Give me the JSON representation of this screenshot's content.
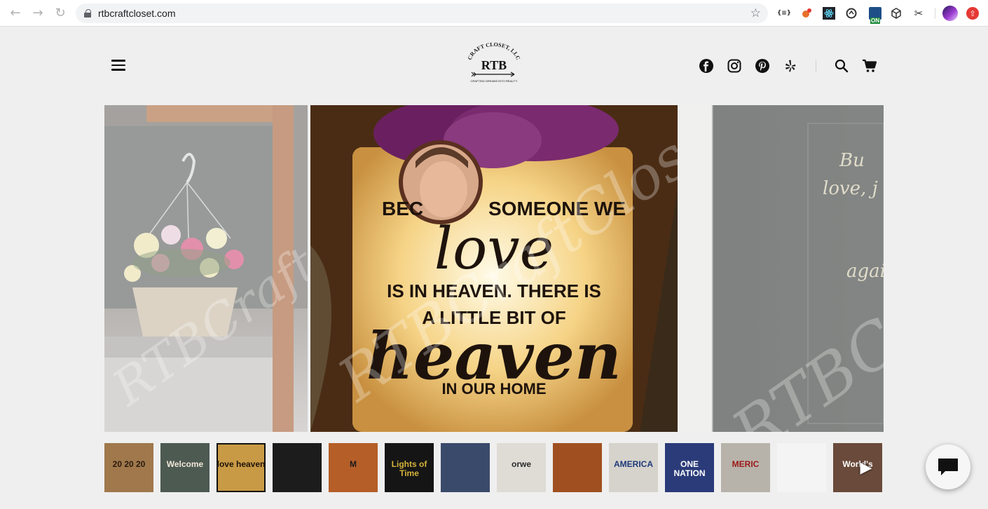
{
  "browser": {
    "url": "rtbcraftcloset.com",
    "back_icon": "arrow-left-icon",
    "forward_icon": "arrow-right-icon",
    "reload_icon": "reload-icon",
    "extensions": [
      "json-viewer-icon",
      "extension-badge-icon",
      "react-devtools-icon",
      "extension-ring-icon",
      "extension-on-icon",
      "cube-icon",
      "scissors-icon",
      "profile-avatar-icon",
      "update-icon"
    ],
    "extension_badge": "ON"
  },
  "site": {
    "logo": {
      "arc_text": "CRAFT CLOSET, LLC",
      "initials": "RTB",
      "tagline": "CRAFTING DREAMS INTO REALITY"
    },
    "social": [
      "facebook-icon",
      "instagram-icon",
      "pinterest-icon",
      "yelp-icon"
    ],
    "actions": [
      "search-icon",
      "cart-icon"
    ],
    "accent": "#111111"
  },
  "slides": {
    "watermark": "RTBCraftCloset",
    "main_text": {
      "line1": "BEC",
      "line1b": "SOMEONE WE",
      "line2": "love",
      "line3": "IS IN HEAVEN. THERE IS",
      "line4": "A LITTLE BIT OF",
      "line5": "heaven",
      "line6": "IN OUR HOME"
    },
    "right_text": {
      "line1": "Bu",
      "line2": "love, j",
      "line3": "agains"
    }
  },
  "thumbnails": [
    {
      "label": "20 20 20",
      "bg": "#a0784c",
      "color": "#2b1a0d"
    },
    {
      "label": "Welcome",
      "bg": "#4c5a52",
      "color": "#f1e7d8"
    },
    {
      "label": "love heaven",
      "bg": "#c99a45",
      "color": "#1e130c"
    },
    {
      "label": "",
      "bg": "#1c1c1c",
      "color": "#d8d0a0"
    },
    {
      "label": "M",
      "bg": "#b55e28",
      "color": "#1a1a1a"
    },
    {
      "label": "Lights of Time",
      "bg": "#151515",
      "color": "#d4b23a"
    },
    {
      "label": "",
      "bg": "#3a4a6a",
      "color": "#ffffff"
    },
    {
      "label": "orwe",
      "bg": "#dfdcd5",
      "color": "#2a2a2a"
    },
    {
      "label": "",
      "bg": "#a05020",
      "color": "#111111"
    },
    {
      "label": "AMERICA",
      "bg": "#d6d3cc",
      "color": "#1f3a7a"
    },
    {
      "label": "ONE NATION",
      "bg": "#2b3b7a",
      "color": "#ffffff"
    },
    {
      "label": "MERIC",
      "bg": "#b8b3aa",
      "color": "#9a1a1a"
    },
    {
      "label": "",
      "bg": "#f4f4f4",
      "color": "#222222"
    },
    {
      "label": "World's",
      "bg": "#6a4a3a",
      "color": "#ffffff"
    }
  ],
  "chat": {
    "icon": "chat-bubble-icon"
  }
}
